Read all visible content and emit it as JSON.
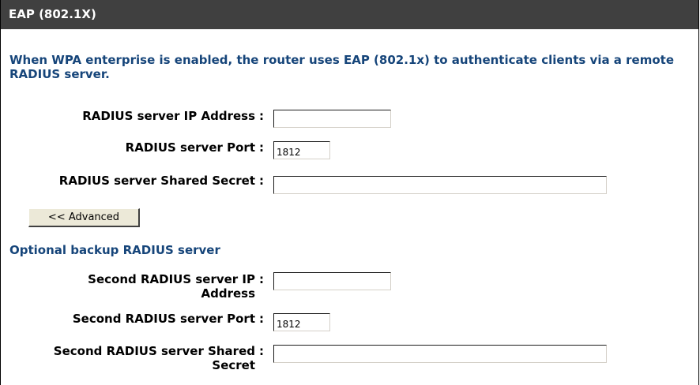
{
  "header": {
    "title": "EAP (802.1X)"
  },
  "intro": {
    "text": "When WPA enterprise is enabled, the router uses EAP (802.1x) to authenticate clients via a remote RADIUS server."
  },
  "primary": {
    "ip_label": "RADIUS server IP Address",
    "ip_value": "",
    "port_label": "RADIUS server Port",
    "port_value": "1812",
    "secret_label": "RADIUS server Shared Secret",
    "secret_value": ""
  },
  "advanced_button": {
    "label": "<< Advanced"
  },
  "backup": {
    "heading": "Optional backup RADIUS server",
    "ip_label_line1": "Second RADIUS server IP",
    "ip_label_line2": "Address",
    "ip_value": "",
    "port_label": "Second RADIUS server Port",
    "port_value": "1812",
    "secret_label_line1": "Second RADIUS server Shared",
    "secret_label_line2": "Secret",
    "secret_value": ""
  },
  "separator": ":",
  "colors": {
    "header_bg": "#404040",
    "accent_text": "#16457a"
  }
}
